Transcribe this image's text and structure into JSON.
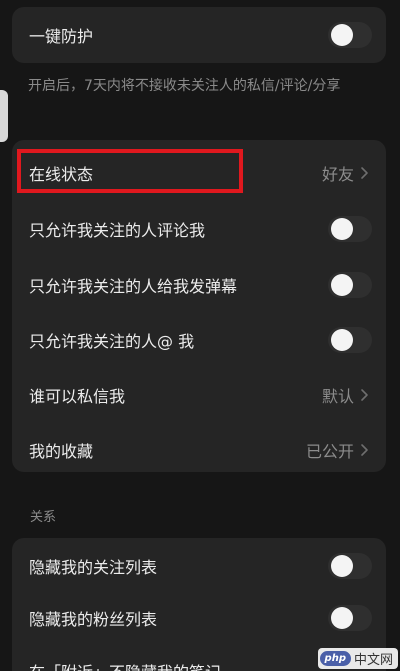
{
  "top": {
    "one_click_protect": {
      "label": "一键防护",
      "enabled": false
    },
    "description": "开启后，7天内将不接收未关注人的私信/评论/分享"
  },
  "privacy": {
    "online_status": {
      "label": "在线状态",
      "value": "好友"
    },
    "only_followed_comment": {
      "label": "只允许我关注的人评论我",
      "enabled": false
    },
    "only_followed_danmaku": {
      "label": "只允许我关注的人给我发弹幕",
      "enabled": false
    },
    "only_followed_mention": {
      "label": "只允许我关注的人@ 我",
      "enabled": false
    },
    "who_can_message": {
      "label": "谁可以私信我",
      "value": "默认"
    },
    "my_favorites": {
      "label": "我的收藏",
      "value": "已公开"
    }
  },
  "relations": {
    "section_title": "关系",
    "hide_following": {
      "label": "隐藏我的关注列表",
      "enabled": false
    },
    "hide_fans": {
      "label": "隐藏我的粉丝列表",
      "enabled": false
    },
    "partial_row": {
      "label": "在「附近」不隐藏我的笔记"
    }
  },
  "watermark": {
    "logo": "php",
    "text": "中文网"
  },
  "colors": {
    "background": "#161616",
    "card": "#252525",
    "highlight": "#e0181e",
    "muted_text": "#8c8c8c"
  }
}
